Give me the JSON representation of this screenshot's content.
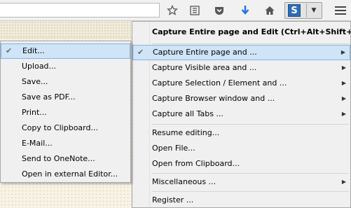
{
  "toolbar": {
    "icons": {
      "bookmark": "star-icon",
      "reading_list": "reading-list-icon",
      "pocket": "pocket-icon",
      "downloads": "download-arrow-icon",
      "home": "home-icon",
      "extension": "s-logo-icon",
      "extension_dropdown": "chevron-down-icon",
      "menu": "hamburger-menu-icon"
    },
    "extension_letter": "S",
    "download_color": "#1a73e8"
  },
  "main_menu": {
    "header": "Capture Entire page and Edit (Ctrl+Alt+Shift+Z)",
    "items": [
      {
        "label": "Capture Entire page and ...",
        "submenu": true,
        "checked": true,
        "highlighted": true
      },
      {
        "label": "Capture Visible area and ...",
        "submenu": true
      },
      {
        "label": "Capture Selection / Element and ...",
        "submenu": true
      },
      {
        "label": "Capture Browser window and ...",
        "submenu": true
      },
      {
        "label": "Capture all Tabs ...",
        "submenu": true
      },
      {
        "label": "Resume editing...",
        "submenu": false
      },
      {
        "label": "Open File...",
        "submenu": false
      },
      {
        "label": "Open from Clipboard...",
        "submenu": false
      },
      {
        "label": "Miscellaneous ...",
        "submenu": true
      },
      {
        "label": "Register ...",
        "submenu": false
      }
    ],
    "check_glyph": "✔",
    "arrow_glyph": "▶"
  },
  "sub_menu": {
    "items": [
      {
        "label": "Edit...",
        "checked": true,
        "highlighted": true
      },
      {
        "label": "Upload..."
      },
      {
        "label": "Save..."
      },
      {
        "label": "Save as PDF..."
      },
      {
        "label": "Print..."
      },
      {
        "label": "Copy to Clipboard..."
      },
      {
        "label": "E-Mail..."
      },
      {
        "label": "Send to OneNote..."
      },
      {
        "label": "Open in external Editor..."
      }
    ],
    "check_glyph": "✔"
  }
}
